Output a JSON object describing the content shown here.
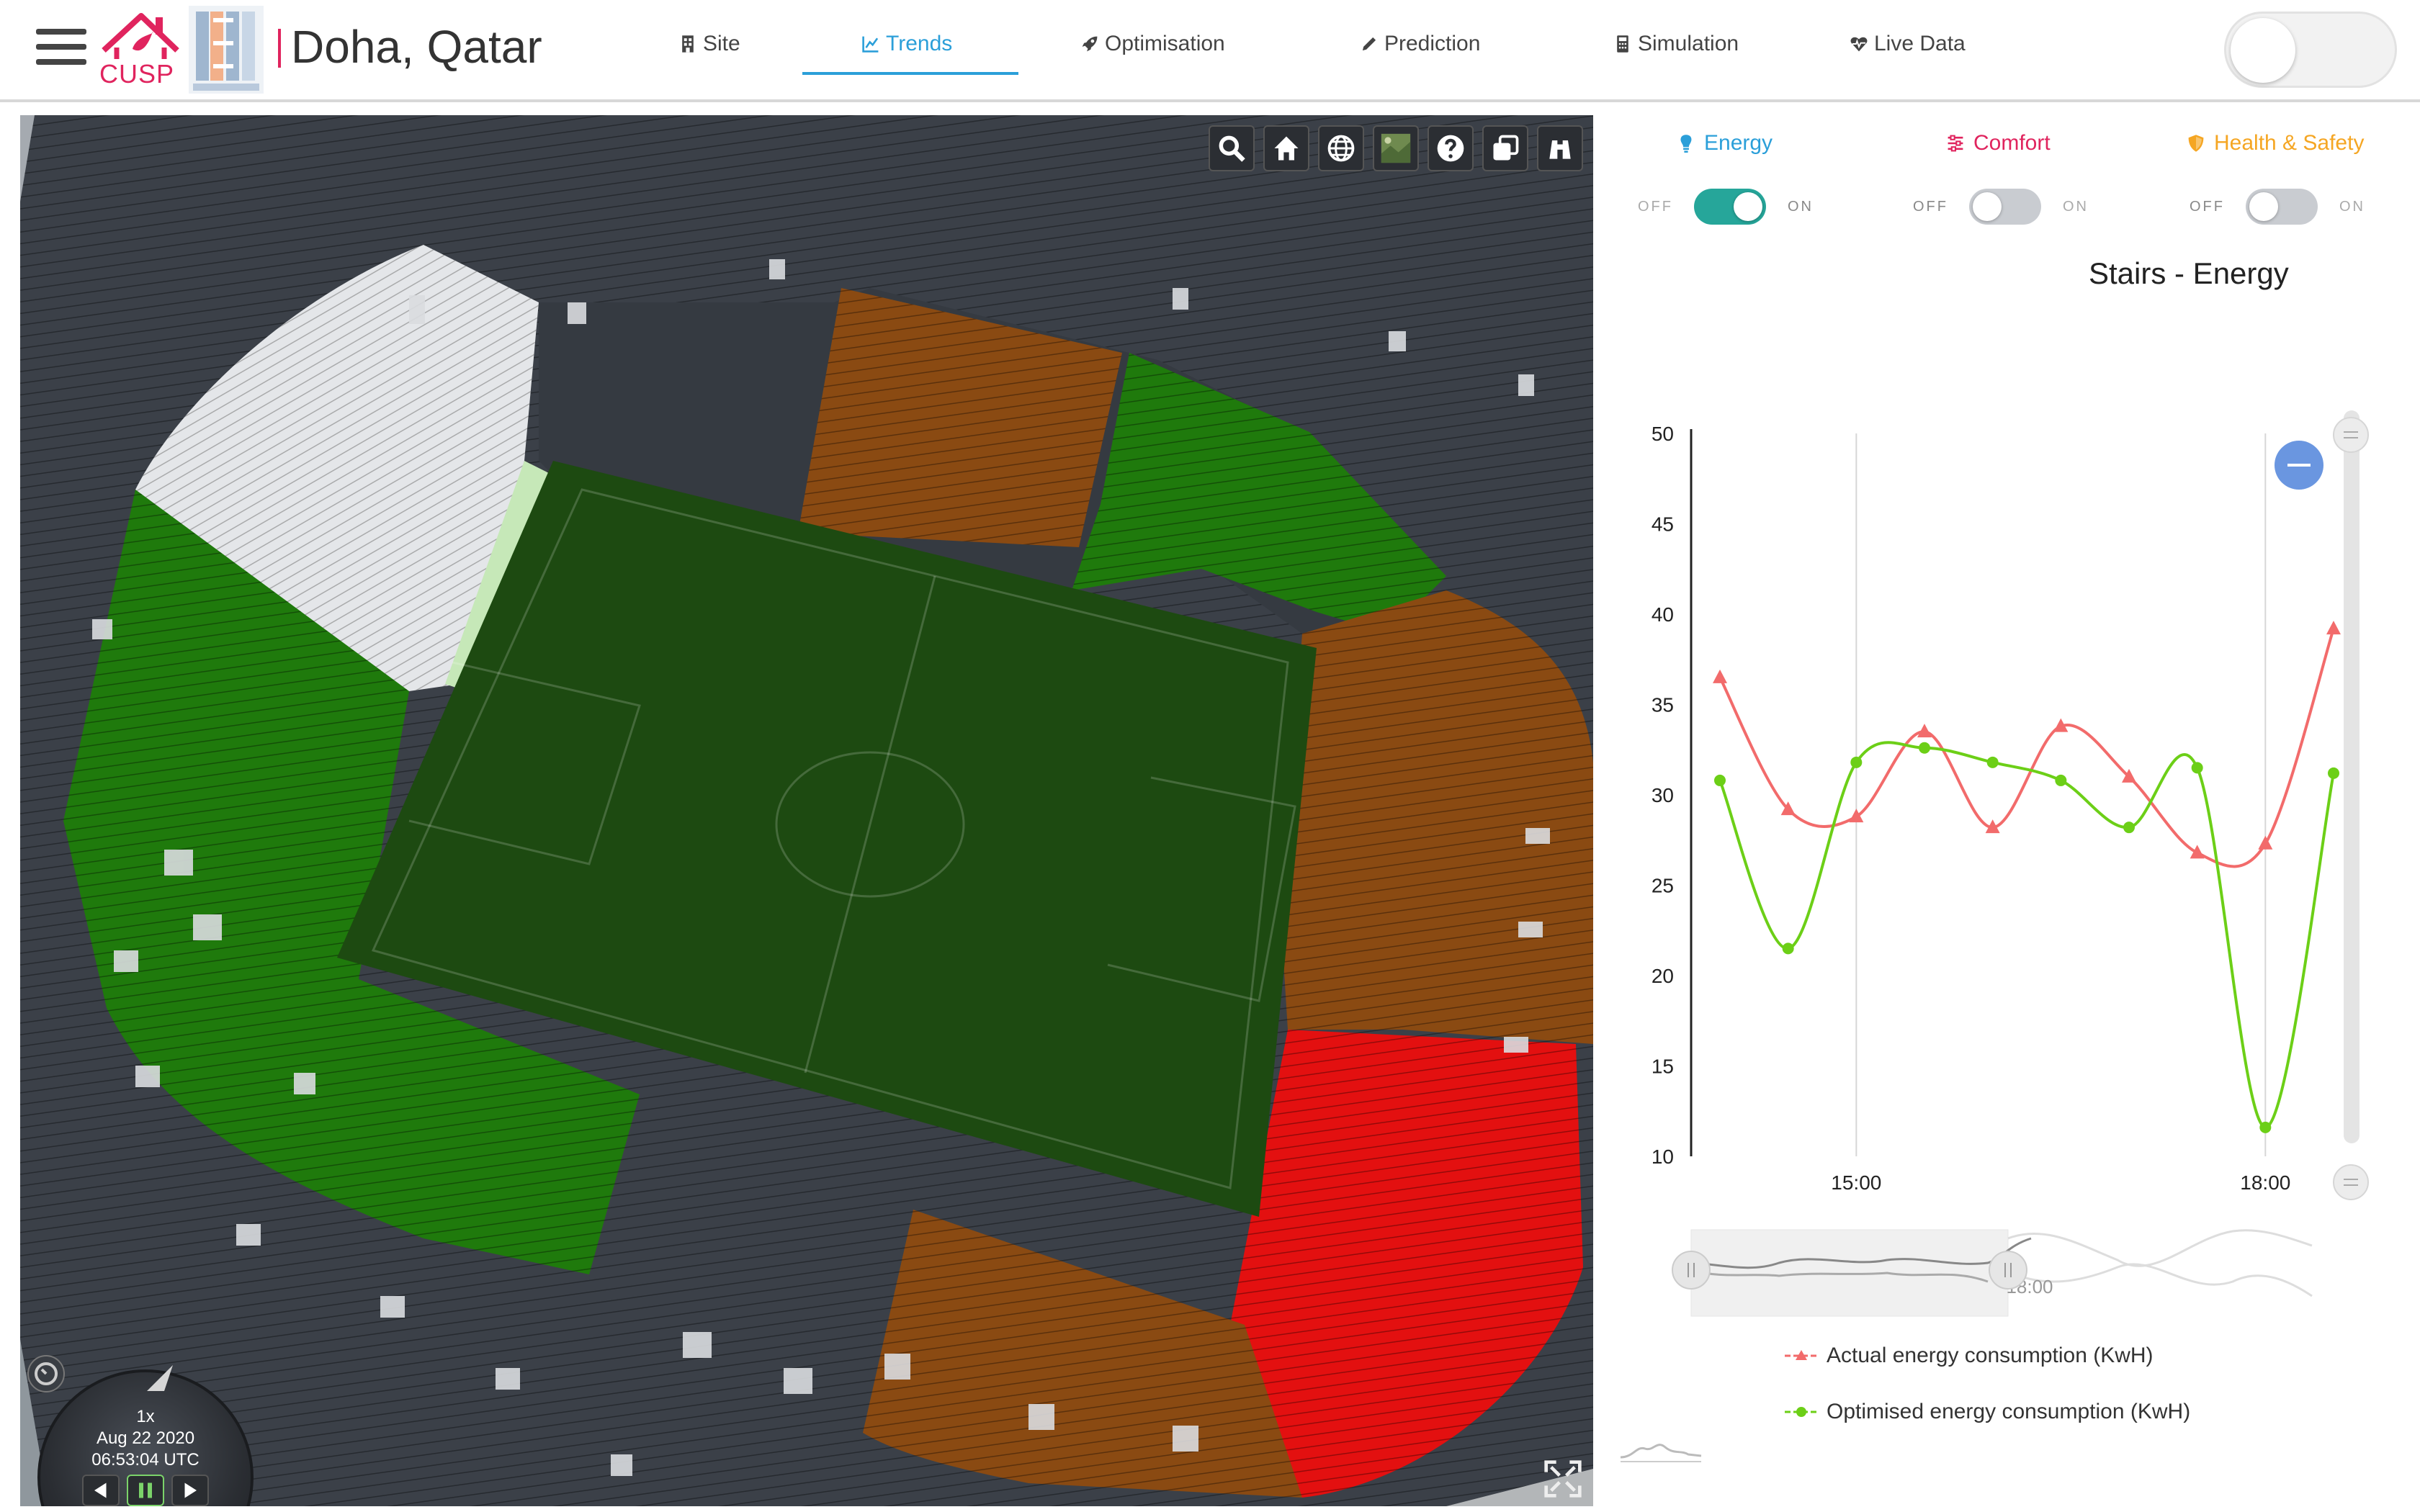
{
  "navbar": {
    "brand_text": "CUSP",
    "city": "Doha, Qatar",
    "items": [
      {
        "label": "Site",
        "icon": "building-icon"
      },
      {
        "label": "Trends",
        "icon": "line-chart-icon"
      },
      {
        "label": "Optimisation",
        "icon": "rocket-icon"
      },
      {
        "label": "Prediction",
        "icon": "pencil-icon"
      },
      {
        "label": "Simulation",
        "icon": "calculator-icon"
      },
      {
        "label": "Live Data",
        "icon": "heartbeat-icon"
      }
    ],
    "active_item": "Trends",
    "accent_color": "#2b9fd9",
    "brand_color": "#e0245e"
  },
  "viewer": {
    "toolbar": [
      "search-icon",
      "home-icon",
      "globe-icon",
      "imagery-icon",
      "help-icon",
      "layers-icon",
      "binoculars-icon"
    ],
    "clock": {
      "speed": "1x",
      "date": "Aug 22 2020",
      "time": "06:53:04 UTC"
    },
    "zone_colors": {
      "green": "#1f7a0c",
      "orange": "#8a4a12",
      "red": "#e31010",
      "white": "#e8eaec",
      "pitch": "#1d4a11"
    }
  },
  "panel": {
    "categories": [
      {
        "label": "Energy",
        "color": "#2b9fd9",
        "switch_on": true
      },
      {
        "label": "Comfort",
        "color": "#e0245e",
        "switch_on": false
      },
      {
        "label": "Health & Safety",
        "color": "#f5a623",
        "switch_on": false
      }
    ],
    "switch_off_label": "OFF",
    "switch_on_label": "ON",
    "switch_on_color": "#26a69a"
  },
  "chart_data": {
    "type": "line",
    "title": "Stairs - Energy",
    "ylim": [
      10,
      50
    ],
    "yticks": [
      "50",
      "45",
      "40",
      "35",
      "30",
      "25",
      "20",
      "15",
      "10"
    ],
    "xticks": [
      "15:00",
      "18:00"
    ],
    "x": [
      "14:00",
      "14:30",
      "15:00",
      "15:30",
      "16:00",
      "16:30",
      "17:00",
      "17:30",
      "18:00",
      "18:30"
    ],
    "series": [
      {
        "name": "Actual energy consumption (KwH)",
        "color": "#f26b6b",
        "marker": "triangle",
        "values": [
          36.5,
          29.2,
          28.8,
          33.5,
          28.2,
          33.8,
          31.0,
          26.8,
          27.3,
          39.2
        ]
      },
      {
        "name": "Optimised energy consumption (KwH)",
        "color": "#6ccf17",
        "marker": "circle",
        "values": [
          30.8,
          21.5,
          31.8,
          32.6,
          31.8,
          30.8,
          28.2,
          31.5,
          11.6,
          31.2
        ]
      }
    ],
    "navigator_label": "18:00",
    "grid": false
  }
}
